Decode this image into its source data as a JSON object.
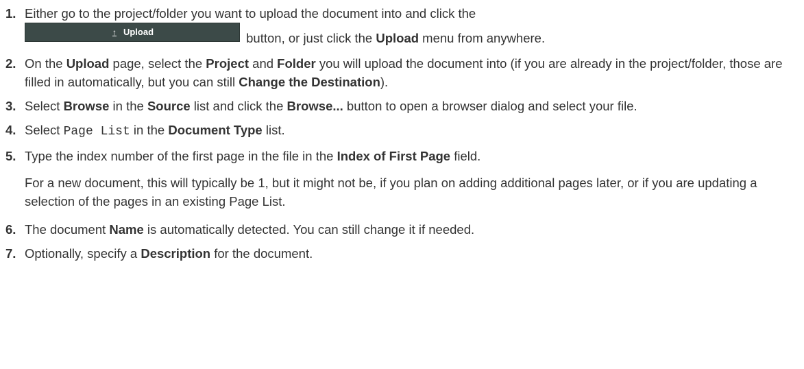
{
  "steps": [
    {
      "num": "1.",
      "line1": "Either go to the project/folder you want to upload the document into and click the",
      "button_icon": "upload-arrow-icon",
      "button_label": "Upload",
      "after_button": "button, or just click the ",
      "bold1": "Upload",
      "tail": " menu from anywhere."
    },
    {
      "num": "2.",
      "t1": "On the ",
      "b1": "Upload",
      "t2": " page, select the ",
      "b2": "Project",
      "t3": " and ",
      "b3": "Folder",
      "t4": " you will upload the document into (if you are already in the project/folder, those are filled in automatically, but you can still ",
      "b4": "Change the Destination",
      "t5": ")."
    },
    {
      "num": "3.",
      "t1": "Select ",
      "b1": "Browse",
      "t2": " in the ",
      "b2": "Source",
      "t3": " list and click the ",
      "b3": "Browse...",
      "t4": " button to open a browser dialog and select your file."
    },
    {
      "num": "4.",
      "t1": "Select ",
      "code": "Page List",
      "t2": " in the ",
      "b1": "Document Type",
      "t3": " list."
    },
    {
      "num": "5.",
      "t1": "Type the index number of the first page in the file in the ",
      "b1": "Index of First Page",
      "t2": " field.",
      "note": "For a new document, this will typically be 1, but it might not be, if you plan on adding additional pages later, or if you are updating a selection of the pages in an existing Page List."
    },
    {
      "num": "6.",
      "t1": "The document ",
      "b1": "Name",
      "t2": " is automatically detected. You can still change it if needed."
    },
    {
      "num": "7.",
      "t1": "Optionally, specify a ",
      "b1": "Description",
      "t2": " for the document."
    }
  ]
}
